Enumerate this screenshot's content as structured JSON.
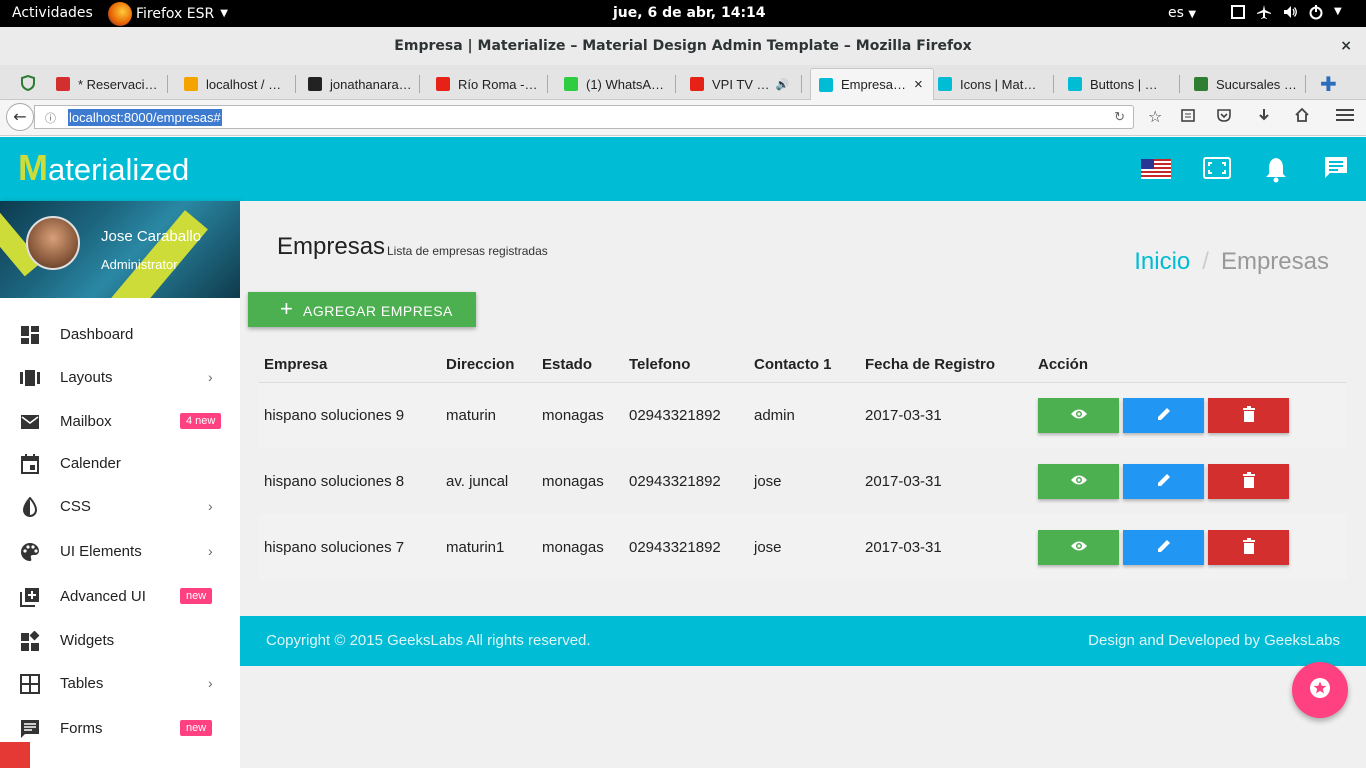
{
  "system": {
    "activities": "Actividades",
    "app": "Firefox ESR",
    "clock": "jue,  6 de abr, 14:14",
    "lang": "es"
  },
  "window": {
    "title": "Empresa | Materialize – Material Design Admin Template – Mozilla Firefox"
  },
  "tabs": [
    {
      "label": "* Reservaci…",
      "color": "#d32f2f"
    },
    {
      "label": "localhost / …",
      "color": "#f4a300"
    },
    {
      "label": "jonathanara…",
      "color": "#222222"
    },
    {
      "label": "Río Roma -…",
      "color": "#e62117"
    },
    {
      "label": "(1) WhatsA…",
      "color": "#2ecc40"
    },
    {
      "label": "VPI TV …",
      "color": "#e62117"
    },
    {
      "label": "Empresa…",
      "color": "#00bcd4"
    },
    {
      "label": "Icons | Mat…",
      "color": "#00bcd4"
    },
    {
      "label": "Buttons | …",
      "color": "#00bcd4"
    },
    {
      "label": "Sucursales …",
      "color": "#2e7d32"
    }
  ],
  "url": "localhost:8000/empresas#",
  "brand": {
    "first": "M",
    "rest": "aterialized"
  },
  "profile": {
    "name": "Jose Caraballo",
    "role": "Administrator"
  },
  "menu": [
    {
      "label": "Dashboard",
      "icon": "dashboard-icon"
    },
    {
      "label": "Layouts",
      "icon": "layouts-icon",
      "chevron": "›"
    },
    {
      "label": "Mailbox",
      "icon": "mail-icon",
      "badge": "4 new"
    },
    {
      "label": "Calender",
      "icon": "calendar-icon"
    },
    {
      "label": "CSS",
      "icon": "invert-colors-icon",
      "chevron": "›"
    },
    {
      "label": "UI Elements",
      "icon": "palette-icon",
      "chevron": "›"
    },
    {
      "label": "Advanced UI",
      "icon": "library-add-icon",
      "badge": "new"
    },
    {
      "label": "Widgets",
      "icon": "widgets-icon"
    },
    {
      "label": "Tables",
      "icon": "border-all-icon",
      "chevron": "›"
    },
    {
      "label": "Forms",
      "icon": "forms-icon",
      "badge": "new"
    }
  ],
  "page": {
    "title": "Empresas",
    "subtitle": "Lista de empresas registradas",
    "breadcrumb_home": "Inicio",
    "breadcrumb_sep": "/",
    "breadcrumb_current": "Empresas",
    "add_button": "AGREGAR EMPRESA",
    "add_plus": "+"
  },
  "table": {
    "headers": [
      "Empresa",
      "Direccion",
      "Estado",
      "Telefono",
      "Contacto 1",
      "Fecha de Registro",
      "Acción"
    ],
    "rows": [
      [
        "hispano soluciones 9",
        "maturin",
        "monagas",
        "02943321892",
        "admin",
        "2017-03-31"
      ],
      [
        "hispano soluciones 8",
        "av. juncal",
        "monagas",
        "02943321892",
        "jose",
        "2017-03-31"
      ],
      [
        "hispano soluciones 7",
        "maturin1",
        "monagas",
        "02943321892",
        "jose",
        "2017-03-31"
      ]
    ]
  },
  "footer": {
    "left": "Copyright © 2015 GeeksLabs All rights reserved.",
    "right": "Design and Developed by GeeksLabs"
  },
  "colors": {
    "primary": "#00bcd4",
    "accent": "#ff4081",
    "success": "#4caf50",
    "info": "#2196f3",
    "danger": "#d32f2f"
  }
}
